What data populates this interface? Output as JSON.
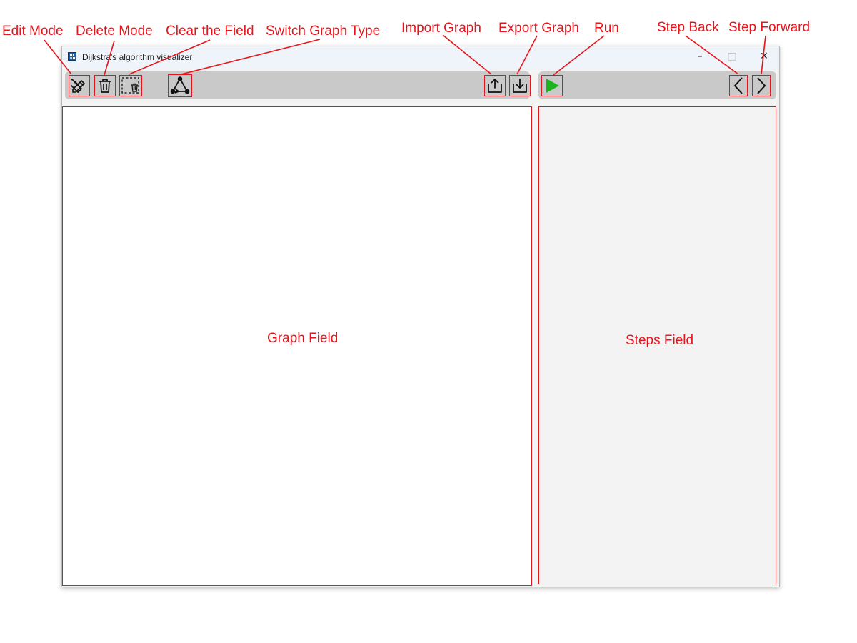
{
  "annotations": {
    "edit_mode": "Edit Mode",
    "delete_mode": "Delete Mode",
    "clear_field": "Clear the Field",
    "switch_graph_type": "Switch Graph Type",
    "import_graph": "Import Graph",
    "export_graph": "Export Graph",
    "run": "Run",
    "step_back": "Step Back",
    "step_forward": "Step Forward"
  },
  "window": {
    "title": "Dijkstra's algorithm visualizer",
    "minimize_glyph": "–",
    "maximize_glyph": "□",
    "close_glyph": "✕"
  },
  "toolbar": {
    "icons": [
      "edit-mode-icon",
      "delete-mode-icon",
      "clear-field-icon",
      "switch-graph-type-icon",
      "import-graph-icon",
      "export-graph-icon",
      "run-icon",
      "step-back-icon",
      "step-forward-icon"
    ]
  },
  "fields": {
    "graph_label": "Graph Field",
    "steps_label": "Steps Field"
  },
  "colors": {
    "annotation": "#e8141c",
    "run_green": "#1db51d",
    "toolbar_bg": "#c9c9c9",
    "steps_bg": "#f3f3f3"
  }
}
